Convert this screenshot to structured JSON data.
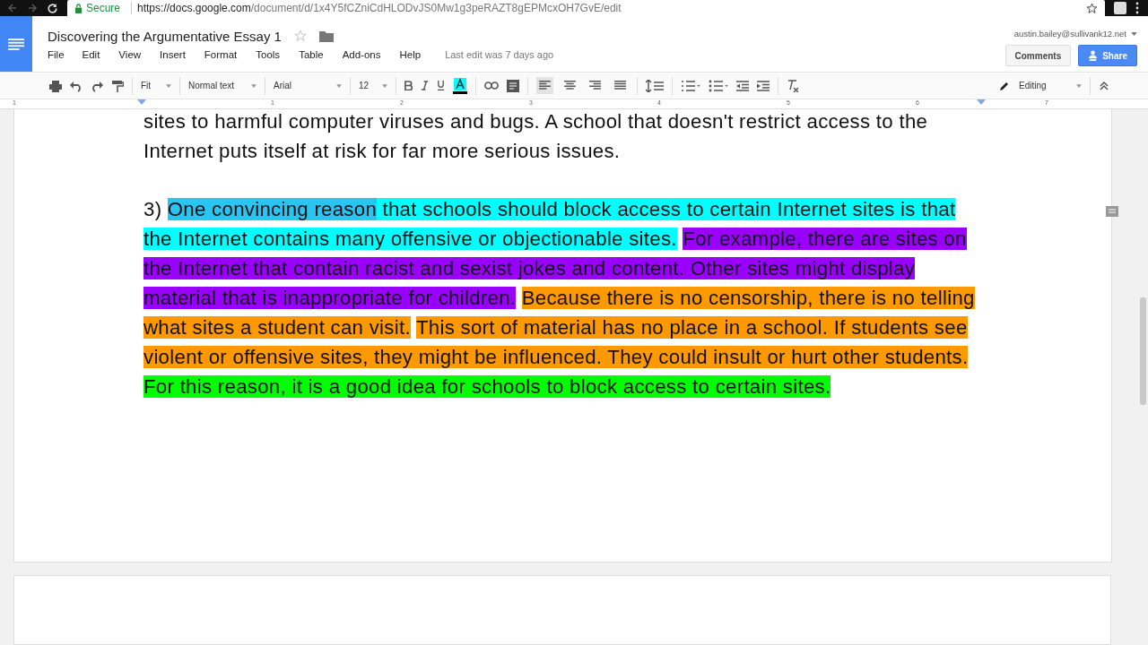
{
  "browser": {
    "secure_label": "Secure",
    "url_host": "https://docs.google.com",
    "url_path": "/document/d/1x4Y5fCZniCdHLODvJS0Mw1g3peRAZT8gEPMcxOH7GvE/edit"
  },
  "header": {
    "title": "Discovering the Argumentative Essay 1",
    "starred": false,
    "menus": [
      "File",
      "Edit",
      "View",
      "Insert",
      "Format",
      "Tools",
      "Table",
      "Add-ons",
      "Help"
    ],
    "last_edit": "Last edit was 7 days ago",
    "account": "austin.bailey@sullivank12.net",
    "comments_button": "Comments",
    "share_button": "Share"
  },
  "toolbar": {
    "zoom": "Fit",
    "style": "Normal text",
    "font": "Arial",
    "size": "12",
    "alignments": [
      {
        "kind": "left",
        "selected": true
      },
      {
        "kind": "center",
        "selected": false
      },
      {
        "kind": "right",
        "selected": false
      },
      {
        "kind": "justify",
        "selected": false
      }
    ],
    "mode": "Editing"
  },
  "ruler": [
    "1",
    "1",
    "2",
    "3",
    "4",
    "5",
    "6",
    "7"
  ],
  "document": {
    "lines_before": [
      "sites to harmful computer viruses and bugs. A school that doesn't restrict access to the",
      "Internet puts itself at risk for far more serious issues."
    ],
    "number": "3)",
    "paragraph": [
      {
        "text": "One convincing reason",
        "color": "#00ffff",
        "selected": true
      },
      {
        "text": " that schools should block access to certain Internet sites is that the Internet contains many offensive or objectionable sites.",
        "color": "#00ffff",
        "selected": false
      },
      {
        "text": "For example, there are sites on the Internet that contain racist and sexist jokes and content. Other sites might display material that is inappropriate for children.",
        "color": "#9900ff",
        "selected": false
      },
      {
        "text": "Because there is no censorship, there is no telling what sites a student can visit.",
        "color": "#ff9900",
        "selected": false
      },
      {
        "text": "This sort of material has no place in a school. If students see violent or offensive sites, they might be influenced. They could insult or hurt other students.",
        "color": "#ff9900",
        "selected": false
      },
      {
        "text": "For this reason, it is a good idea for schools to block access to certain sites.",
        "color": "#00ff00",
        "selected": false
      }
    ]
  }
}
